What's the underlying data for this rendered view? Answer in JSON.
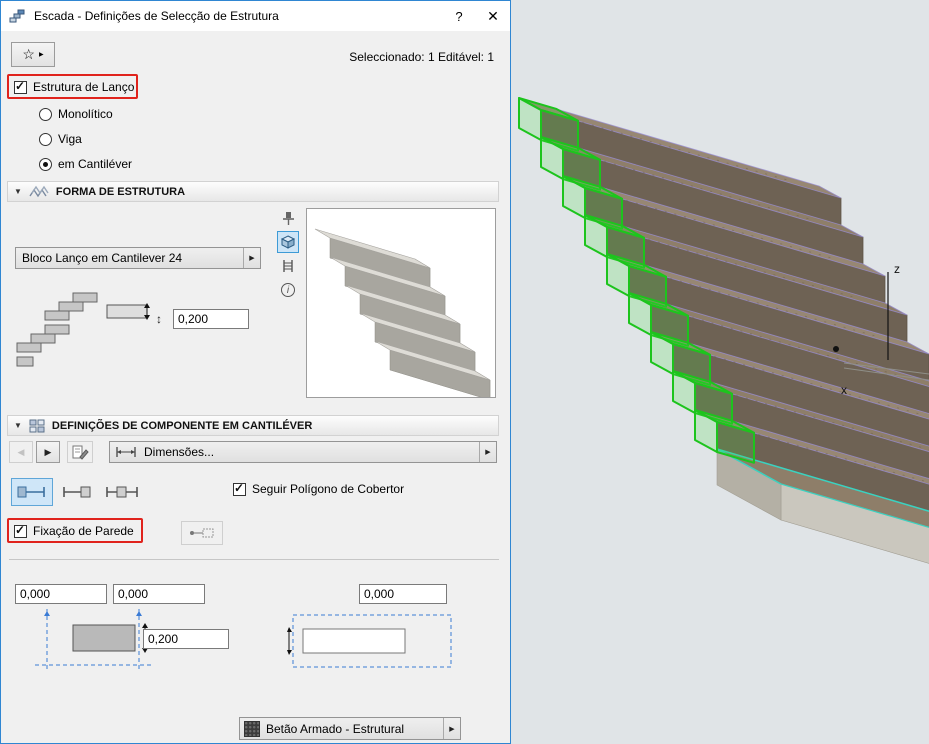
{
  "window": {
    "title": "Escada - Definições de Selecção de Estrutura",
    "help_label": "?",
    "close_label": "✕"
  },
  "toolbar": {
    "favorites_star": "☆",
    "selection_status": "Seleccionado: 1 Editável: 1"
  },
  "structure": {
    "flight_checkbox": "Estrutura de Lanço",
    "radio_monolithic": "Monolítico",
    "radio_beam": "Viga",
    "radio_cantilever": "em Cantiléver"
  },
  "forma": {
    "title": "FORMA DE ESTRUTURA",
    "type_dropdown": "Bloco Lanço em Cantilever 24",
    "thickness": "0,200",
    "thickness_arrow": "↕"
  },
  "componente": {
    "title": "DEFINIÇÕES DE COMPONENTE EM CANTILÉVER",
    "prev_arrow": "◀",
    "next_arrow": "▶",
    "dimensions_dropdown": "Dimensões...",
    "follow_polygon": "Seguir Polígono de Cobertor",
    "wall_fixing": "Fixação de Parede"
  },
  "geometry": {
    "offset_a": "0,000",
    "offset_b": "0,000",
    "offset_c": "0,000",
    "height": "0,200"
  },
  "material": {
    "value": "Betão Armado - Estrutural"
  },
  "viewport": {
    "axis_z": "z",
    "axis_x": "x"
  },
  "colors": {
    "annotation_red": "#e0231c",
    "window_border_blue": "#2f86d2",
    "selection_green": "#1dc41d",
    "highlight_blue": "#cfe6f8"
  }
}
